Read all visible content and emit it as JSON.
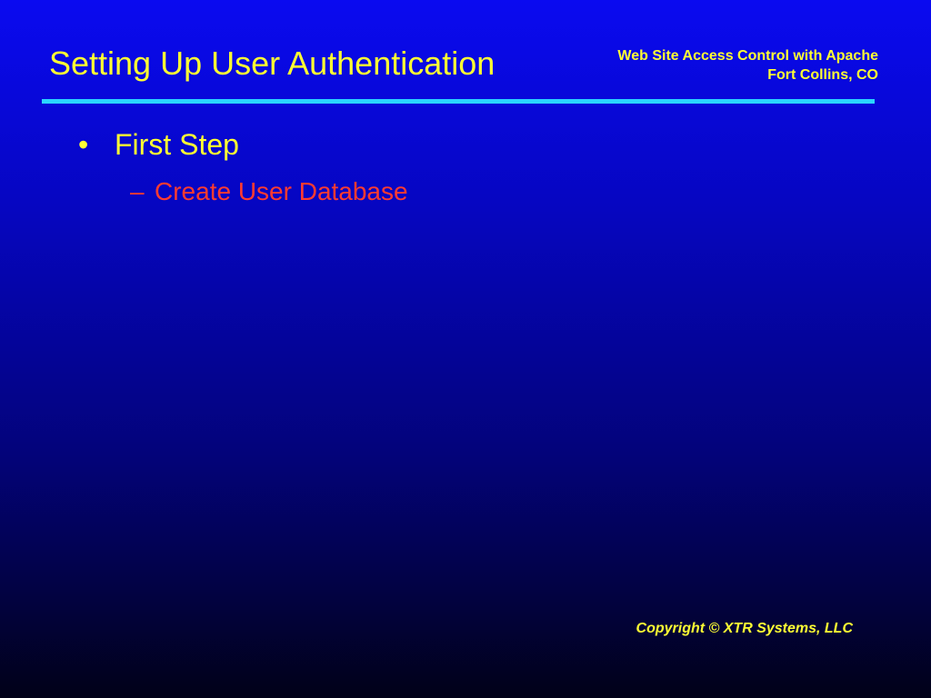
{
  "slide": {
    "title": "Setting Up User Authentication",
    "header": {
      "line1": "Web Site Access Control with Apache",
      "line2": "Fort Collins, CO"
    },
    "bullets": [
      {
        "marker": "•",
        "text": "First Step",
        "subitems": [
          {
            "marker": "–",
            "text": "Create User Database"
          }
        ]
      }
    ],
    "footer": {
      "copyright": "Copyright © XTR Systems, LLC"
    }
  },
  "colors": {
    "title_text": "#ffff33",
    "subitem_text": "#ff3b30",
    "rule": "#2ad4ff",
    "background_top": "#0a0af0",
    "background_bottom": "#010118"
  }
}
